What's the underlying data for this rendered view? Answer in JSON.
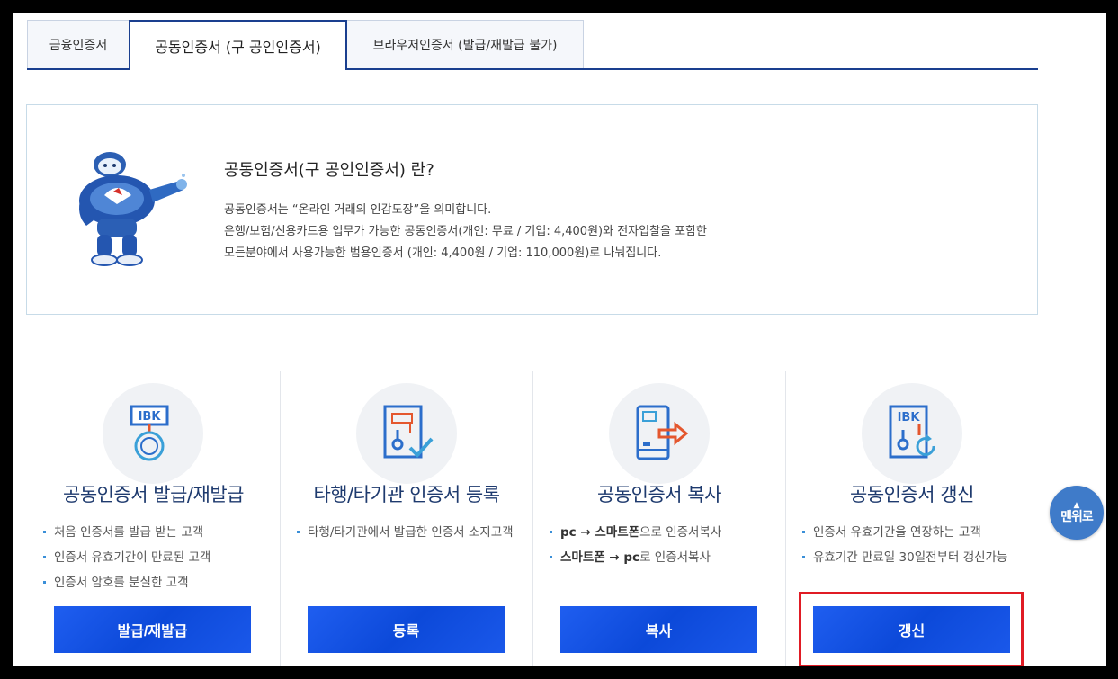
{
  "tabs": [
    {
      "label": "금융인증서",
      "active": false
    },
    {
      "label": "공동인증서 (구 공인인증서)",
      "active": true
    },
    {
      "label": "브라우저인증서 (발급/재발급 불가)",
      "active": false
    }
  ],
  "intro": {
    "title": "공동인증서(구 공인인증서) 란?",
    "lines": [
      "공동인증서는 “온라인 거래의 인감도장”을 의미합니다.",
      "은행/보험/신용카드용 업무가 가능한 공동인증서(개인: 무료 / 기업: 4,400원)와 전자입찰을 포함한",
      "모든분야에서 사용가능한 범용인증서 (개인: 4,400원 / 기업: 110,000원)로 나눠집니다."
    ]
  },
  "services": [
    {
      "icon": "ibk-medal-icon",
      "title": "공동인증서 발급/재발급",
      "items": [
        "처음 인증서를 발급 받는 고객",
        "인증서 유효기간이 만료된 고객",
        "인증서 암호를 분실한 고객"
      ],
      "button": "발급/재발급"
    },
    {
      "icon": "certificate-register-icon",
      "title": "타행/타기관 인증서 등록",
      "items": [
        "타행/타기관에서 발급한 인증서 소지고객"
      ],
      "button": "등록"
    },
    {
      "icon": "phone-copy-icon",
      "title": "공동인증서 복사",
      "items_rich": [
        {
          "a": "pc → 스마트폰",
          "b": "으로 인증서복사"
        },
        {
          "a": "스마트폰 → pc",
          "b": "로 인증서복사"
        }
      ],
      "button": "복사"
    },
    {
      "icon": "ibk-renew-icon",
      "title": "공동인증서 갱신",
      "items": [
        "인증서 유효기간을 연장하는 고객",
        "유효기간 만료일 30일전부터 갱신가능"
      ],
      "button": "갱신"
    }
  ],
  "top_button": {
    "label": "맨위로",
    "arrow": "▲"
  },
  "colors": {
    "brand_navy": "#1a3f8f",
    "button_blue": "#0c49d9",
    "highlight_red": "#e01b24"
  },
  "icon_text": {
    "ibk": "IBK"
  }
}
